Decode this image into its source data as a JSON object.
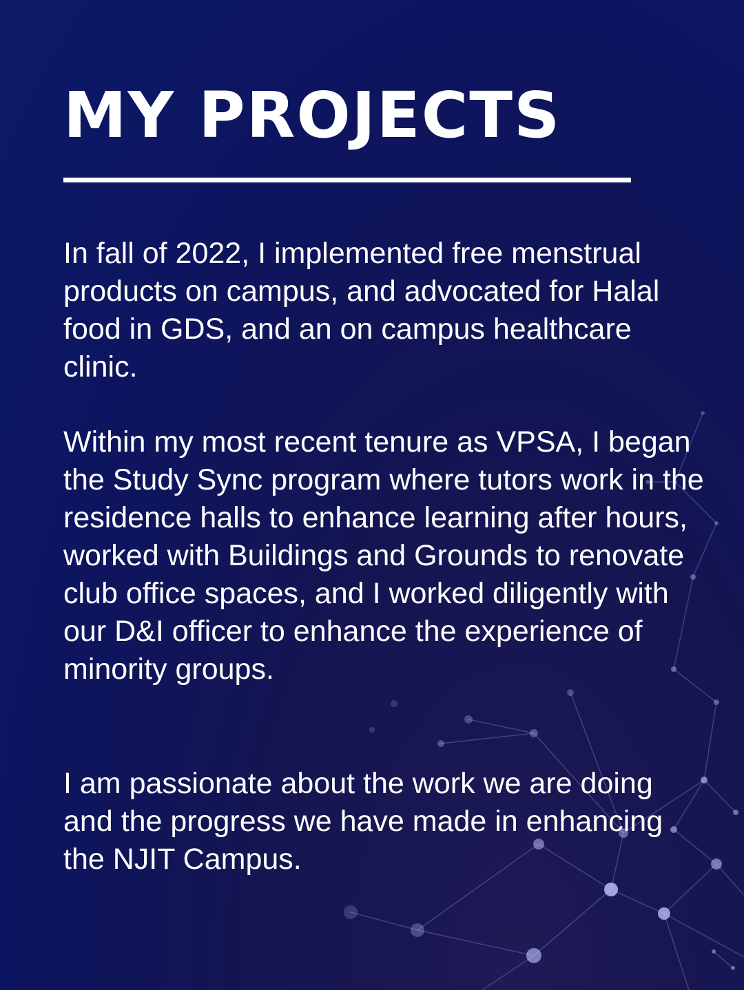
{
  "page": {
    "title": "MY PROJECTS",
    "paragraphs": [
      "In fall of 2022, I implemented free menstrual products on campus, and advocated for Halal food in GDS, and an on campus healthcare clinic.",
      "Within my most recent tenure as VPSA, I began the Study Sync program where tutors work in the residence halls to enhance learning after hours, worked with Buildings and Grounds to renovate club office spaces, and I worked diligently with our D&I officer to enhance the experience of minority groups.",
      "I am passionate about the work we are doing and the progress we have made in enhancing the NJIT Campus."
    ]
  },
  "colors": {
    "background": "#0d1560",
    "text": "#ffffff",
    "network": "#b7b9ff"
  },
  "icons": {
    "background_decoration": "network-graph-icon"
  }
}
